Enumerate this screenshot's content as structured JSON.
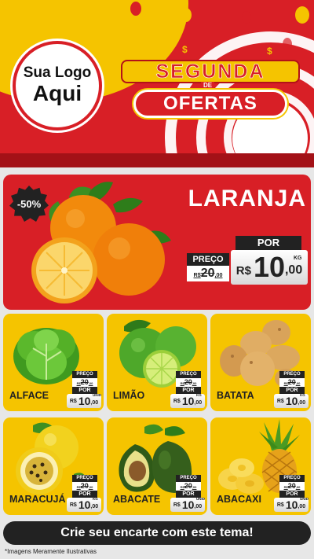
{
  "header": {
    "logo_line1": "Sua Logo",
    "logo_line2": "Aqui",
    "title_top": "SEGUNDA",
    "title_de": "DE",
    "title_bottom": "OFERTAS"
  },
  "featured": {
    "discount": "-50%",
    "name": "LARANJA",
    "preco_label": "PREÇO",
    "por_label": "POR",
    "currency": "R$",
    "old_price_int": "20",
    "old_price_dec": ",00",
    "new_price_int": "10",
    "new_price_dec": ",00",
    "unit": "KG"
  },
  "products": [
    {
      "name": "ALFACE",
      "preco_label": "PREÇO",
      "old_currency": "R$",
      "old_price_int": "20",
      "old_price_dec": ",00",
      "por_label": "POR",
      "currency": "R$",
      "price_int": "10",
      "price_dec": ",00",
      "unit": "UNID"
    },
    {
      "name": "LIMÃO",
      "preco_label": "PREÇO",
      "old_currency": "R$",
      "old_price_int": "20",
      "old_price_dec": ",00",
      "por_label": "POR",
      "currency": "R$",
      "price_int": "10",
      "price_dec": ",00",
      "unit": "KG"
    },
    {
      "name": "BATATA",
      "preco_label": "PREÇO",
      "old_currency": "R$",
      "old_price_int": "20",
      "old_price_dec": ",00",
      "por_label": "POR",
      "currency": "R$",
      "price_int": "10",
      "price_dec": ",00",
      "unit": "KG"
    },
    {
      "name": "MARACUJÁ",
      "preco_label": "PREÇO",
      "old_currency": "R$",
      "old_price_int": "20",
      "old_price_dec": ",00",
      "por_label": "POR",
      "currency": "R$",
      "price_int": "10",
      "price_dec": ",00",
      "unit": "KG"
    },
    {
      "name": "ABACATE",
      "preco_label": "PREÇO",
      "old_currency": "R$",
      "old_price_int": "20",
      "old_price_dec": ",00",
      "por_label": "POR",
      "currency": "R$",
      "price_int": "10",
      "price_dec": ",00",
      "unit": "UNID"
    },
    {
      "name": "ABACAXI",
      "preco_label": "PREÇO",
      "old_currency": "R$",
      "old_price_int": "20",
      "old_price_dec": ",00",
      "por_label": "POR",
      "currency": "R$",
      "price_int": "10",
      "price_dec": ",00",
      "unit": "UNID"
    }
  ],
  "footer": {
    "cta": "Crie seu encarte com este tema!",
    "disclaimer": "*Imagens Meramente Ilustrativas"
  },
  "colors": {
    "brand_red": "#d81f26",
    "brand_yellow": "#f5c400",
    "dark": "#222222"
  },
  "icons": [
    "orange-illustration",
    "lettuce-illustration",
    "lime-illustration",
    "potato-illustration",
    "passion-fruit-illustration",
    "avocado-illustration",
    "pineapple-illustration",
    "balloon-icon",
    "dollar-sign-icon"
  ]
}
